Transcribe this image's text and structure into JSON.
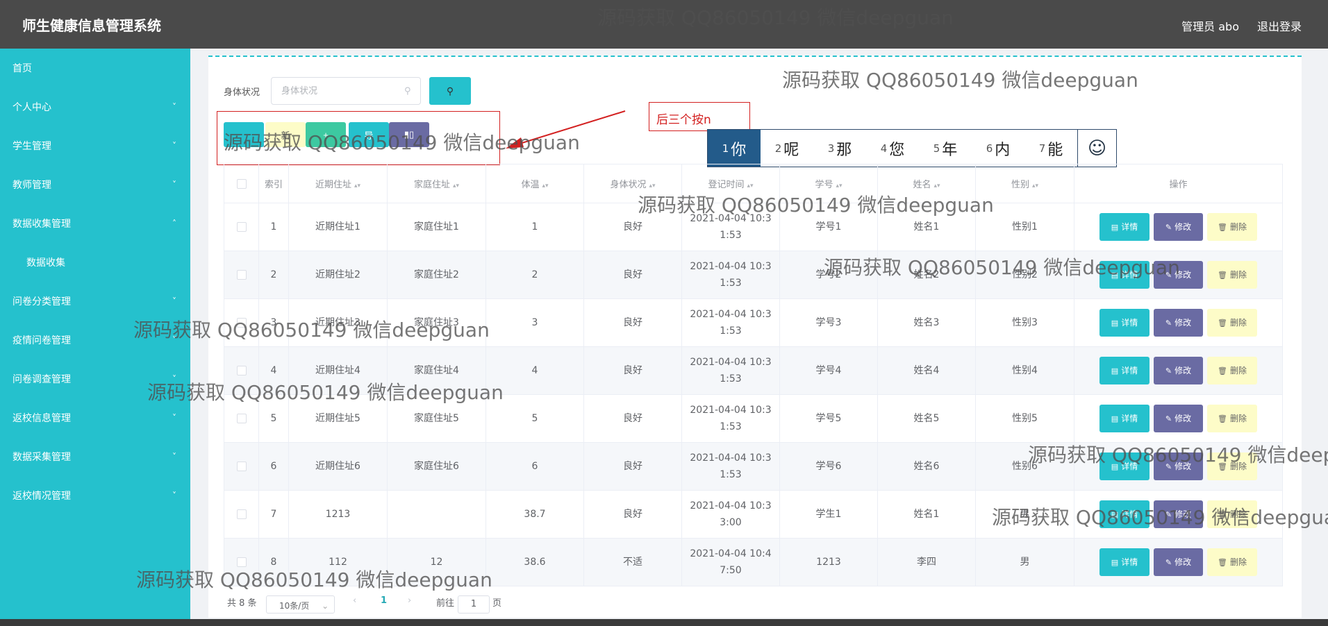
{
  "app": {
    "title": "师生健康信息管理系统",
    "user": "管理员 abo",
    "logout": "退出登录"
  },
  "sidebar": {
    "items": [
      {
        "label": "首页",
        "expandable": false
      },
      {
        "label": "个人中心",
        "expandable": true
      },
      {
        "label": "学生管理",
        "expandable": true
      },
      {
        "label": "教师管理",
        "expandable": true
      },
      {
        "label": "数据收集管理",
        "expandable": true,
        "expanded": true
      },
      {
        "label": "数据收集",
        "sub": true
      },
      {
        "label": "问卷分类管理",
        "expandable": true
      },
      {
        "label": "疫情问卷管理",
        "expandable": true
      },
      {
        "label": "问卷调查管理",
        "expandable": true
      },
      {
        "label": "返校信息管理",
        "expandable": true
      },
      {
        "label": "数据采集管理",
        "expandable": true
      },
      {
        "label": "返校情况管理",
        "expandable": true
      }
    ]
  },
  "search": {
    "label": "身体状况",
    "placeholder": "身体状况"
  },
  "toolbar": {
    "btn2_label": "新",
    "btn3_label": "导"
  },
  "ime": {
    "composition": "后三个按n",
    "candidates": [
      {
        "n": "1",
        "w": "你"
      },
      {
        "n": "2",
        "w": "呢"
      },
      {
        "n": "3",
        "w": "那"
      },
      {
        "n": "4",
        "w": "您"
      },
      {
        "n": "5",
        "w": "年"
      },
      {
        "n": "6",
        "w": "内"
      },
      {
        "n": "7",
        "w": "能"
      }
    ]
  },
  "table": {
    "headers": [
      "索引",
      "近期住址",
      "家庭住址",
      "体温",
      "身体状况",
      "登记时间",
      "学号",
      "姓名",
      "性别",
      "操作"
    ],
    "rows": [
      [
        "1",
        "近期住址1",
        "家庭住址1",
        "1",
        "良好",
        "2021-04-04 10:3",
        "1:53",
        "学号1",
        "姓名1",
        "性别1"
      ],
      [
        "2",
        "近期住址2",
        "家庭住址2",
        "2",
        "良好",
        "2021-04-04 10:3",
        "1:53",
        "学号2",
        "姓名2",
        "性别2"
      ],
      [
        "3",
        "近期住址3",
        "家庭住址3",
        "3",
        "良好",
        "2021-04-04 10:3",
        "1:53",
        "学号3",
        "姓名3",
        "性别3"
      ],
      [
        "4",
        "近期住址4",
        "家庭住址4",
        "4",
        "良好",
        "2021-04-04 10:3",
        "1:53",
        "学号4",
        "姓名4",
        "性别4"
      ],
      [
        "5",
        "近期住址5",
        "家庭住址5",
        "5",
        "良好",
        "2021-04-04 10:3",
        "1:53",
        "学号5",
        "姓名5",
        "性别5"
      ],
      [
        "6",
        "近期住址6",
        "家庭住址6",
        "6",
        "良好",
        "2021-04-04 10:3",
        "1:53",
        "学号6",
        "姓名6",
        "性别6"
      ],
      [
        "7",
        "1213",
        "",
        "38.7",
        "良好",
        "2021-04-04 10:3",
        "3:00",
        "学生1",
        "姓名1",
        "男"
      ],
      [
        "8",
        "112",
        "12",
        "38.6",
        "不适",
        "2021-04-04 10:4",
        "7:50",
        "1213",
        "李四",
        "男"
      ]
    ],
    "actions": {
      "detail": "详情",
      "edit": "修改",
      "delete": "删除"
    }
  },
  "pagination": {
    "total": "共 8 条",
    "page_size": "10条/页",
    "current": "1",
    "goto_prefix": "前往",
    "goto_value": "1",
    "goto_suffix": "页"
  },
  "watermark": "源码获取 QQ86050149 微信deepguan",
  "colors": {
    "sidebar": "#25c1cd",
    "header": "#4a4a4a",
    "detail": "#25c1cd",
    "edit": "#6a6ba3",
    "delete": "#fdfcc8",
    "annotation": "#d32020"
  }
}
